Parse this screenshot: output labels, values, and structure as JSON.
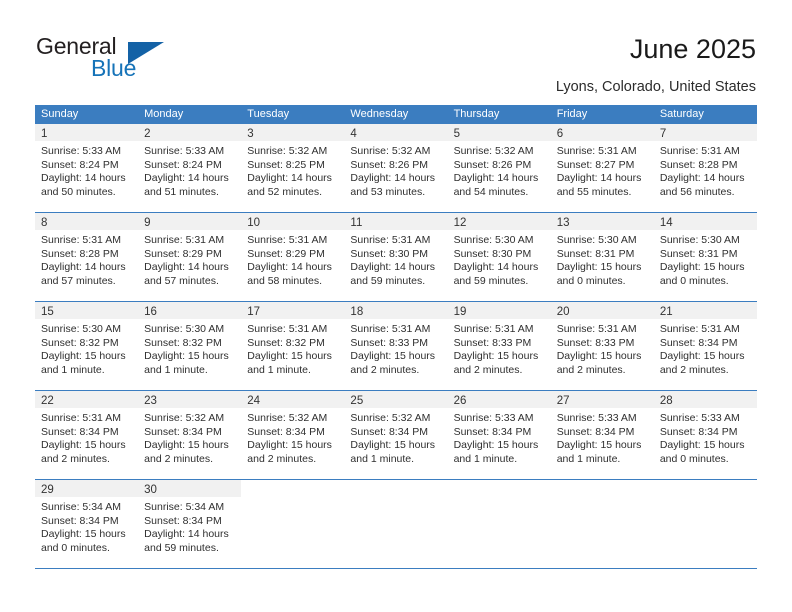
{
  "brand": {
    "name_top": "General",
    "name_bottom": "Blue",
    "triangle_icon": "triangle-icon",
    "accent_color": "#1462a6"
  },
  "header": {
    "title": "June 2025",
    "subtitle": "Lyons, Colorado, United States"
  },
  "calendar": {
    "header_color": "#3b7dc0",
    "weekdays": [
      "Sunday",
      "Monday",
      "Tuesday",
      "Wednesday",
      "Thursday",
      "Friday",
      "Saturday"
    ],
    "weeks": [
      [
        {
          "day": "1",
          "sunrise": "Sunrise: 5:33 AM",
          "sunset": "Sunset: 8:24 PM",
          "daylight1": "Daylight: 14 hours",
          "daylight2": "and 50 minutes."
        },
        {
          "day": "2",
          "sunrise": "Sunrise: 5:33 AM",
          "sunset": "Sunset: 8:24 PM",
          "daylight1": "Daylight: 14 hours",
          "daylight2": "and 51 minutes."
        },
        {
          "day": "3",
          "sunrise": "Sunrise: 5:32 AM",
          "sunset": "Sunset: 8:25 PM",
          "daylight1": "Daylight: 14 hours",
          "daylight2": "and 52 minutes."
        },
        {
          "day": "4",
          "sunrise": "Sunrise: 5:32 AM",
          "sunset": "Sunset: 8:26 PM",
          "daylight1": "Daylight: 14 hours",
          "daylight2": "and 53 minutes."
        },
        {
          "day": "5",
          "sunrise": "Sunrise: 5:32 AM",
          "sunset": "Sunset: 8:26 PM",
          "daylight1": "Daylight: 14 hours",
          "daylight2": "and 54 minutes."
        },
        {
          "day": "6",
          "sunrise": "Sunrise: 5:31 AM",
          "sunset": "Sunset: 8:27 PM",
          "daylight1": "Daylight: 14 hours",
          "daylight2": "and 55 minutes."
        },
        {
          "day": "7",
          "sunrise": "Sunrise: 5:31 AM",
          "sunset": "Sunset: 8:28 PM",
          "daylight1": "Daylight: 14 hours",
          "daylight2": "and 56 minutes."
        }
      ],
      [
        {
          "day": "8",
          "sunrise": "Sunrise: 5:31 AM",
          "sunset": "Sunset: 8:28 PM",
          "daylight1": "Daylight: 14 hours",
          "daylight2": "and 57 minutes."
        },
        {
          "day": "9",
          "sunrise": "Sunrise: 5:31 AM",
          "sunset": "Sunset: 8:29 PM",
          "daylight1": "Daylight: 14 hours",
          "daylight2": "and 57 minutes."
        },
        {
          "day": "10",
          "sunrise": "Sunrise: 5:31 AM",
          "sunset": "Sunset: 8:29 PM",
          "daylight1": "Daylight: 14 hours",
          "daylight2": "and 58 minutes."
        },
        {
          "day": "11",
          "sunrise": "Sunrise: 5:31 AM",
          "sunset": "Sunset: 8:30 PM",
          "daylight1": "Daylight: 14 hours",
          "daylight2": "and 59 minutes."
        },
        {
          "day": "12",
          "sunrise": "Sunrise: 5:30 AM",
          "sunset": "Sunset: 8:30 PM",
          "daylight1": "Daylight: 14 hours",
          "daylight2": "and 59 minutes."
        },
        {
          "day": "13",
          "sunrise": "Sunrise: 5:30 AM",
          "sunset": "Sunset: 8:31 PM",
          "daylight1": "Daylight: 15 hours",
          "daylight2": "and 0 minutes."
        },
        {
          "day": "14",
          "sunrise": "Sunrise: 5:30 AM",
          "sunset": "Sunset: 8:31 PM",
          "daylight1": "Daylight: 15 hours",
          "daylight2": "and 0 minutes."
        }
      ],
      [
        {
          "day": "15",
          "sunrise": "Sunrise: 5:30 AM",
          "sunset": "Sunset: 8:32 PM",
          "daylight1": "Daylight: 15 hours",
          "daylight2": "and 1 minute."
        },
        {
          "day": "16",
          "sunrise": "Sunrise: 5:30 AM",
          "sunset": "Sunset: 8:32 PM",
          "daylight1": "Daylight: 15 hours",
          "daylight2": "and 1 minute."
        },
        {
          "day": "17",
          "sunrise": "Sunrise: 5:31 AM",
          "sunset": "Sunset: 8:32 PM",
          "daylight1": "Daylight: 15 hours",
          "daylight2": "and 1 minute."
        },
        {
          "day": "18",
          "sunrise": "Sunrise: 5:31 AM",
          "sunset": "Sunset: 8:33 PM",
          "daylight1": "Daylight: 15 hours",
          "daylight2": "and 2 minutes."
        },
        {
          "day": "19",
          "sunrise": "Sunrise: 5:31 AM",
          "sunset": "Sunset: 8:33 PM",
          "daylight1": "Daylight: 15 hours",
          "daylight2": "and 2 minutes."
        },
        {
          "day": "20",
          "sunrise": "Sunrise: 5:31 AM",
          "sunset": "Sunset: 8:33 PM",
          "daylight1": "Daylight: 15 hours",
          "daylight2": "and 2 minutes."
        },
        {
          "day": "21",
          "sunrise": "Sunrise: 5:31 AM",
          "sunset": "Sunset: 8:34 PM",
          "daylight1": "Daylight: 15 hours",
          "daylight2": "and 2 minutes."
        }
      ],
      [
        {
          "day": "22",
          "sunrise": "Sunrise: 5:31 AM",
          "sunset": "Sunset: 8:34 PM",
          "daylight1": "Daylight: 15 hours",
          "daylight2": "and 2 minutes."
        },
        {
          "day": "23",
          "sunrise": "Sunrise: 5:32 AM",
          "sunset": "Sunset: 8:34 PM",
          "daylight1": "Daylight: 15 hours",
          "daylight2": "and 2 minutes."
        },
        {
          "day": "24",
          "sunrise": "Sunrise: 5:32 AM",
          "sunset": "Sunset: 8:34 PM",
          "daylight1": "Daylight: 15 hours",
          "daylight2": "and 2 minutes."
        },
        {
          "day": "25",
          "sunrise": "Sunrise: 5:32 AM",
          "sunset": "Sunset: 8:34 PM",
          "daylight1": "Daylight: 15 hours",
          "daylight2": "and 1 minute."
        },
        {
          "day": "26",
          "sunrise": "Sunrise: 5:33 AM",
          "sunset": "Sunset: 8:34 PM",
          "daylight1": "Daylight: 15 hours",
          "daylight2": "and 1 minute."
        },
        {
          "day": "27",
          "sunrise": "Sunrise: 5:33 AM",
          "sunset": "Sunset: 8:34 PM",
          "daylight1": "Daylight: 15 hours",
          "daylight2": "and 1 minute."
        },
        {
          "day": "28",
          "sunrise": "Sunrise: 5:33 AM",
          "sunset": "Sunset: 8:34 PM",
          "daylight1": "Daylight: 15 hours",
          "daylight2": "and 0 minutes."
        }
      ],
      [
        {
          "day": "29",
          "sunrise": "Sunrise: 5:34 AM",
          "sunset": "Sunset: 8:34 PM",
          "daylight1": "Daylight: 15 hours",
          "daylight2": "and 0 minutes."
        },
        {
          "day": "30",
          "sunrise": "Sunrise: 5:34 AM",
          "sunset": "Sunset: 8:34 PM",
          "daylight1": "Daylight: 14 hours",
          "daylight2": "and 59 minutes."
        },
        {
          "day": "",
          "sunrise": "",
          "sunset": "",
          "daylight1": "",
          "daylight2": ""
        },
        {
          "day": "",
          "sunrise": "",
          "sunset": "",
          "daylight1": "",
          "daylight2": ""
        },
        {
          "day": "",
          "sunrise": "",
          "sunset": "",
          "daylight1": "",
          "daylight2": ""
        },
        {
          "day": "",
          "sunrise": "",
          "sunset": "",
          "daylight1": "",
          "daylight2": ""
        },
        {
          "day": "",
          "sunrise": "",
          "sunset": "",
          "daylight1": "",
          "daylight2": ""
        }
      ]
    ]
  }
}
